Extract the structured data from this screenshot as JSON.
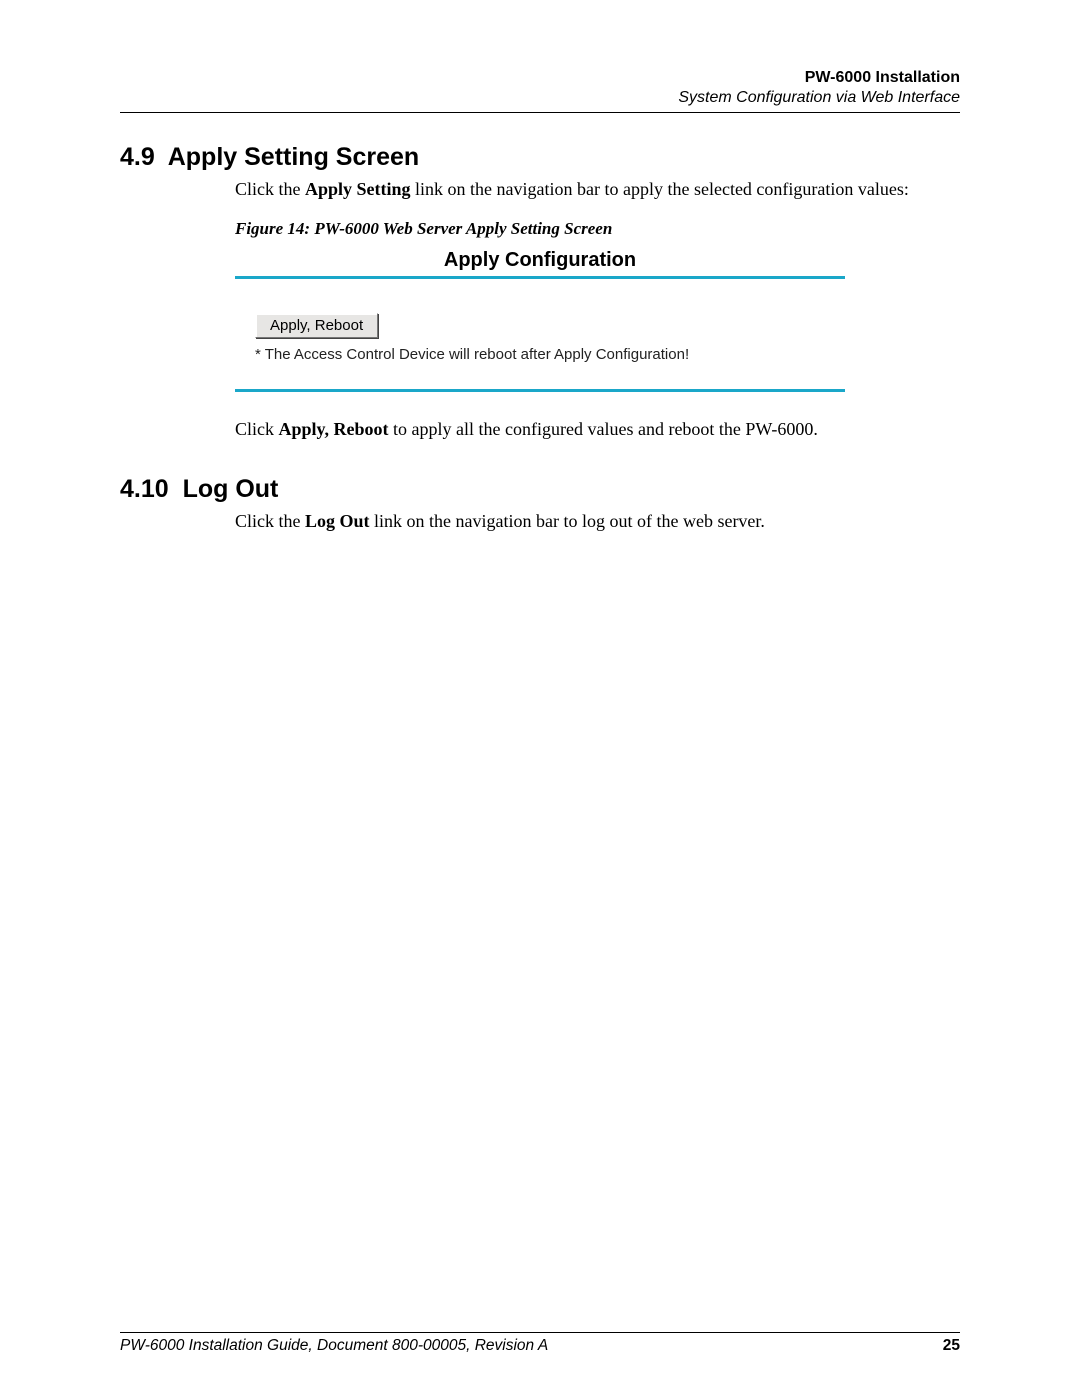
{
  "header": {
    "title": "PW-6000 Installation",
    "subtitle": "System Configuration via Web Interface"
  },
  "section1": {
    "number": "4.9",
    "title": "Apply Setting Screen",
    "para1_pre": "Click the ",
    "para1_bold": "Apply Setting",
    "para1_post": " link on the navigation bar to apply the selected configuration values:",
    "figure_caption": "Figure 14:    PW-6000 Web Server Apply Setting Screen",
    "ui": {
      "title": "Apply Configuration",
      "button_label": "Apply, Reboot",
      "note": "* The Access Control Device will reboot after Apply Configuration!"
    },
    "para2_pre": "Click ",
    "para2_bold": "Apply, Reboot",
    "para2_post": " to apply all the configured values and reboot the PW-6000."
  },
  "section2": {
    "number": "4.10",
    "title": "Log Out",
    "para1_pre": "Click the ",
    "para1_bold": "Log Out",
    "para1_post": " link on the navigation bar to log out of the web server."
  },
  "footer": {
    "text": "PW-6000 Installation Guide, Document 800-00005, Revision A",
    "page": "25"
  }
}
